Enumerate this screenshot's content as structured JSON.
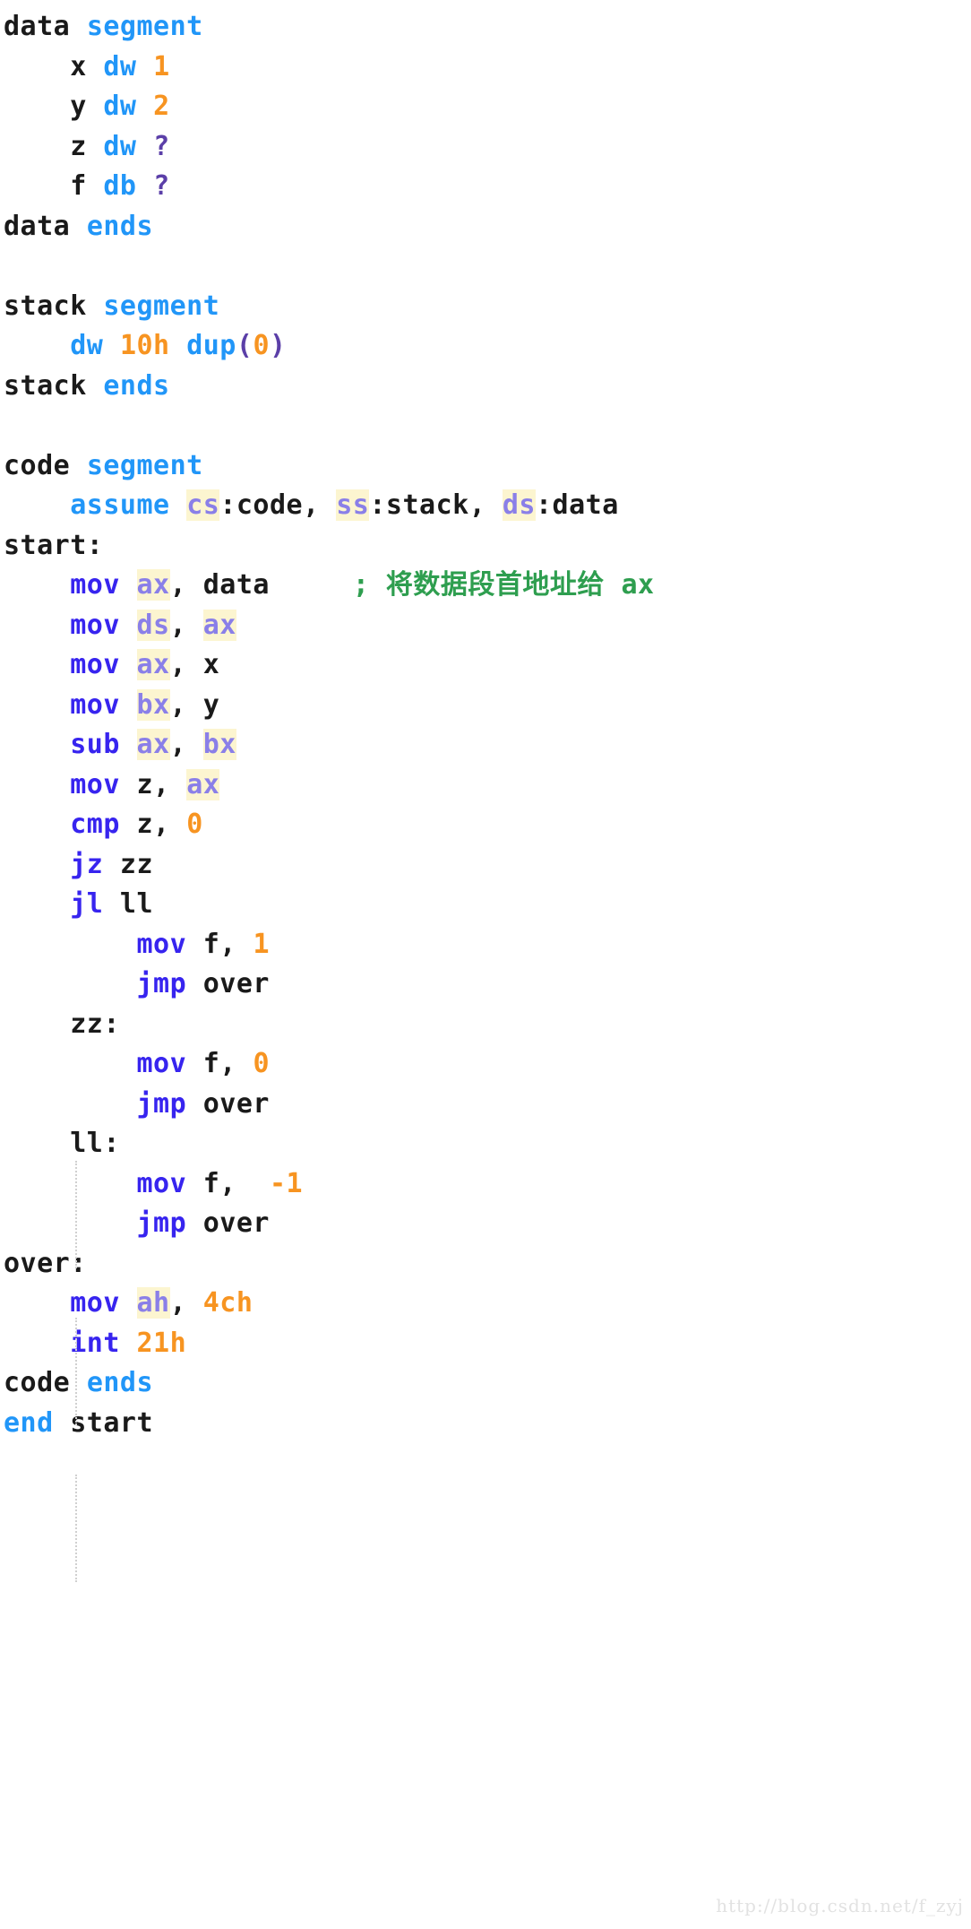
{
  "document": {
    "kind": "assembly-source-listing",
    "language": "x86 Assembly (MASM)",
    "watermark": "http://blog.csdn.net/f_zyj"
  },
  "colors": {
    "background": "#ffffff",
    "plain": "#1a1a1a",
    "keyword": "#2196f8",
    "instruction": "#3724ef",
    "register": "#8a7fe8",
    "register_highlight_bg": "#fcf5d0",
    "number": "#f79421",
    "question": "#5b3fa8",
    "comment": "#2e9e4f",
    "watermark": "#e2e2e2",
    "indent_guide": "#d0d0d0"
  },
  "lines": [
    {
      "n": 1,
      "indent": 0,
      "tokens": [
        {
          "t": "data",
          "c": "plain"
        },
        {
          "t": " ",
          "c": "plain"
        },
        {
          "t": "segment",
          "c": "kw"
        }
      ]
    },
    {
      "n": 2,
      "indent": 4,
      "tokens": [
        {
          "t": "x",
          "c": "plain"
        },
        {
          "t": " ",
          "c": "plain"
        },
        {
          "t": "dw",
          "c": "kw"
        },
        {
          "t": " ",
          "c": "plain"
        },
        {
          "t": "1",
          "c": "num"
        }
      ]
    },
    {
      "n": 3,
      "indent": 4,
      "tokens": [
        {
          "t": "y",
          "c": "plain"
        },
        {
          "t": " ",
          "c": "plain"
        },
        {
          "t": "dw",
          "c": "kw"
        },
        {
          "t": " ",
          "c": "plain"
        },
        {
          "t": "2",
          "c": "num"
        }
      ]
    },
    {
      "n": 4,
      "indent": 4,
      "tokens": [
        {
          "t": "z",
          "c": "plain"
        },
        {
          "t": " ",
          "c": "plain"
        },
        {
          "t": "dw",
          "c": "kw"
        },
        {
          "t": " ",
          "c": "plain"
        },
        {
          "t": "?",
          "c": "q"
        }
      ]
    },
    {
      "n": 5,
      "indent": 4,
      "tokens": [
        {
          "t": "f",
          "c": "plain"
        },
        {
          "t": " ",
          "c": "plain"
        },
        {
          "t": "db",
          "c": "kw"
        },
        {
          "t": " ",
          "c": "plain"
        },
        {
          "t": "?",
          "c": "q"
        }
      ]
    },
    {
      "n": 6,
      "indent": 0,
      "tokens": [
        {
          "t": "data",
          "c": "plain"
        },
        {
          "t": " ",
          "c": "plain"
        },
        {
          "t": "ends",
          "c": "kw"
        }
      ]
    },
    {
      "n": 7,
      "indent": 0,
      "tokens": []
    },
    {
      "n": 8,
      "indent": 0,
      "tokens": [
        {
          "t": "stack",
          "c": "plain"
        },
        {
          "t": " ",
          "c": "plain"
        },
        {
          "t": "segment",
          "c": "kw"
        }
      ]
    },
    {
      "n": 9,
      "indent": 4,
      "tokens": [
        {
          "t": "dw",
          "c": "kw"
        },
        {
          "t": " ",
          "c": "plain"
        },
        {
          "t": "10h",
          "c": "num"
        },
        {
          "t": " ",
          "c": "plain"
        },
        {
          "t": "dup",
          "c": "kw"
        },
        {
          "t": "(",
          "c": "q"
        },
        {
          "t": "0",
          "c": "num"
        },
        {
          "t": ")",
          "c": "q"
        }
      ]
    },
    {
      "n": 10,
      "indent": 0,
      "tokens": [
        {
          "t": "stack",
          "c": "plain"
        },
        {
          "t": " ",
          "c": "plain"
        },
        {
          "t": "ends",
          "c": "kw"
        }
      ]
    },
    {
      "n": 11,
      "indent": 0,
      "tokens": []
    },
    {
      "n": 12,
      "indent": 0,
      "tokens": [
        {
          "t": "code",
          "c": "plain"
        },
        {
          "t": " ",
          "c": "plain"
        },
        {
          "t": "segment",
          "c": "kw"
        }
      ]
    },
    {
      "n": 13,
      "indent": 4,
      "tokens": [
        {
          "t": "assume",
          "c": "kw"
        },
        {
          "t": " ",
          "c": "plain"
        },
        {
          "t": "cs",
          "c": "reg"
        },
        {
          "t": ":code,",
          "c": "plain"
        },
        {
          "t": " ",
          "c": "plain"
        },
        {
          "t": "ss",
          "c": "reg"
        },
        {
          "t": ":stack,",
          "c": "plain"
        },
        {
          "t": " ",
          "c": "plain"
        },
        {
          "t": "ds",
          "c": "reg"
        },
        {
          "t": ":data",
          "c": "plain"
        }
      ]
    },
    {
      "n": 14,
      "indent": 0,
      "tokens": [
        {
          "t": "start:",
          "c": "label"
        }
      ]
    },
    {
      "n": 15,
      "indent": 4,
      "tokens": [
        {
          "t": "mov",
          "c": "instr"
        },
        {
          "t": " ",
          "c": "plain"
        },
        {
          "t": "ax",
          "c": "reg"
        },
        {
          "t": ",",
          "c": "plain"
        },
        {
          "t": " data",
          "c": "plain"
        },
        {
          "t": "     ",
          "c": "plain"
        },
        {
          "t": "; 将数据段首地址给 ax",
          "c": "cmt"
        }
      ]
    },
    {
      "n": 16,
      "indent": 4,
      "tokens": [
        {
          "t": "mov",
          "c": "instr"
        },
        {
          "t": " ",
          "c": "plain"
        },
        {
          "t": "ds",
          "c": "reg"
        },
        {
          "t": ",",
          "c": "plain"
        },
        {
          "t": " ",
          "c": "plain"
        },
        {
          "t": "ax",
          "c": "reg"
        }
      ]
    },
    {
      "n": 17,
      "indent": 4,
      "tokens": [
        {
          "t": "mov",
          "c": "instr"
        },
        {
          "t": " ",
          "c": "plain"
        },
        {
          "t": "ax",
          "c": "reg"
        },
        {
          "t": ",",
          "c": "plain"
        },
        {
          "t": " x",
          "c": "plain"
        }
      ]
    },
    {
      "n": 18,
      "indent": 4,
      "tokens": [
        {
          "t": "mov",
          "c": "instr"
        },
        {
          "t": " ",
          "c": "plain"
        },
        {
          "t": "bx",
          "c": "reg"
        },
        {
          "t": ",",
          "c": "plain"
        },
        {
          "t": " y",
          "c": "plain"
        }
      ]
    },
    {
      "n": 19,
      "indent": 4,
      "tokens": [
        {
          "t": "sub",
          "c": "instr"
        },
        {
          "t": " ",
          "c": "plain"
        },
        {
          "t": "ax",
          "c": "reg"
        },
        {
          "t": ",",
          "c": "plain"
        },
        {
          "t": " ",
          "c": "plain"
        },
        {
          "t": "bx",
          "c": "reg"
        }
      ]
    },
    {
      "n": 20,
      "indent": 4,
      "tokens": [
        {
          "t": "mov",
          "c": "instr"
        },
        {
          "t": " z,",
          "c": "plain"
        },
        {
          "t": " ",
          "c": "plain"
        },
        {
          "t": "ax",
          "c": "reg"
        }
      ]
    },
    {
      "n": 21,
      "indent": 4,
      "tokens": [
        {
          "t": "cmp",
          "c": "instr"
        },
        {
          "t": " z,",
          "c": "plain"
        },
        {
          "t": " ",
          "c": "plain"
        },
        {
          "t": "0",
          "c": "num"
        }
      ]
    },
    {
      "n": 22,
      "indent": 4,
      "tokens": [
        {
          "t": "jz",
          "c": "instr"
        },
        {
          "t": " zz",
          "c": "plain"
        }
      ]
    },
    {
      "n": 23,
      "indent": 4,
      "tokens": [
        {
          "t": "jl",
          "c": "instr"
        },
        {
          "t": " ll",
          "c": "plain"
        }
      ]
    },
    {
      "n": 24,
      "indent": 8,
      "tokens": [
        {
          "t": "mov",
          "c": "instr"
        },
        {
          "t": " f,",
          "c": "plain"
        },
        {
          "t": " ",
          "c": "plain"
        },
        {
          "t": "1",
          "c": "num"
        }
      ]
    },
    {
      "n": 25,
      "indent": 8,
      "tokens": [
        {
          "t": "jmp",
          "c": "instr"
        },
        {
          "t": " over",
          "c": "plain"
        }
      ]
    },
    {
      "n": 26,
      "indent": 4,
      "tokens": [
        {
          "t": "zz:",
          "c": "label"
        }
      ]
    },
    {
      "n": 27,
      "indent": 8,
      "tokens": [
        {
          "t": "mov",
          "c": "instr"
        },
        {
          "t": " f,",
          "c": "plain"
        },
        {
          "t": " ",
          "c": "plain"
        },
        {
          "t": "0",
          "c": "num"
        }
      ]
    },
    {
      "n": 28,
      "indent": 8,
      "tokens": [
        {
          "t": "jmp",
          "c": "instr"
        },
        {
          "t": " over",
          "c": "plain"
        }
      ]
    },
    {
      "n": 29,
      "indent": 4,
      "tokens": [
        {
          "t": "ll:",
          "c": "label"
        }
      ]
    },
    {
      "n": 30,
      "indent": 8,
      "tokens": [
        {
          "t": "mov",
          "c": "instr"
        },
        {
          "t": " f,",
          "c": "plain"
        },
        {
          "t": "  ",
          "c": "plain"
        },
        {
          "t": "-1",
          "c": "num"
        }
      ]
    },
    {
      "n": 31,
      "indent": 8,
      "tokens": [
        {
          "t": "jmp",
          "c": "instr"
        },
        {
          "t": " over",
          "c": "plain"
        }
      ]
    },
    {
      "n": 32,
      "indent": 0,
      "tokens": [
        {
          "t": "over:",
          "c": "label"
        }
      ]
    },
    {
      "n": 33,
      "indent": 4,
      "tokens": [
        {
          "t": "mov",
          "c": "instr"
        },
        {
          "t": " ",
          "c": "plain"
        },
        {
          "t": "ah",
          "c": "reg"
        },
        {
          "t": ",",
          "c": "plain"
        },
        {
          "t": " ",
          "c": "plain"
        },
        {
          "t": "4ch",
          "c": "num"
        }
      ]
    },
    {
      "n": 34,
      "indent": 4,
      "tokens": [
        {
          "t": "int",
          "c": "instr"
        },
        {
          "t": " ",
          "c": "plain"
        },
        {
          "t": "21h",
          "c": "num"
        }
      ]
    },
    {
      "n": 35,
      "indent": 0,
      "tokens": [
        {
          "t": "code",
          "c": "plain"
        },
        {
          "t": " ",
          "c": "plain"
        },
        {
          "t": "ends",
          "c": "kw"
        }
      ]
    },
    {
      "n": 36,
      "indent": 0,
      "tokens": [
        {
          "t": "end",
          "c": "kw"
        },
        {
          "t": " start",
          "c": "plain"
        }
      ]
    }
  ]
}
